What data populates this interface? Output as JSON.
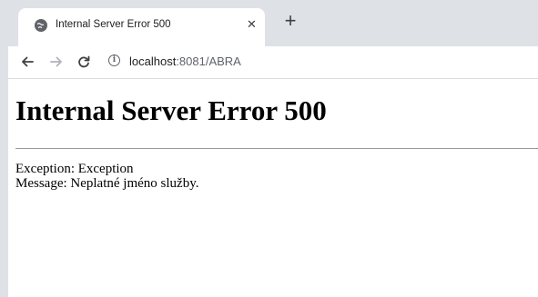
{
  "browser": {
    "tab": {
      "title": "Internal Server Error 500",
      "favicon": "globe-icon",
      "close": "✕"
    },
    "new_tab": "+",
    "nav": {
      "back": "back-arrow-icon",
      "forward": "forward-arrow-icon",
      "reload": "reload-icon"
    },
    "address": {
      "host": "localhost",
      "rest": ":8081/ABRA",
      "info": "i"
    }
  },
  "page": {
    "heading": "Internal Server Error 500",
    "exception_line": "Exception: Exception",
    "message_line": "Message: Neplatné jméno služby."
  },
  "colors": {
    "tabstrip": "#dee1e6",
    "icon": "#5f6368",
    "text": "#202124"
  }
}
